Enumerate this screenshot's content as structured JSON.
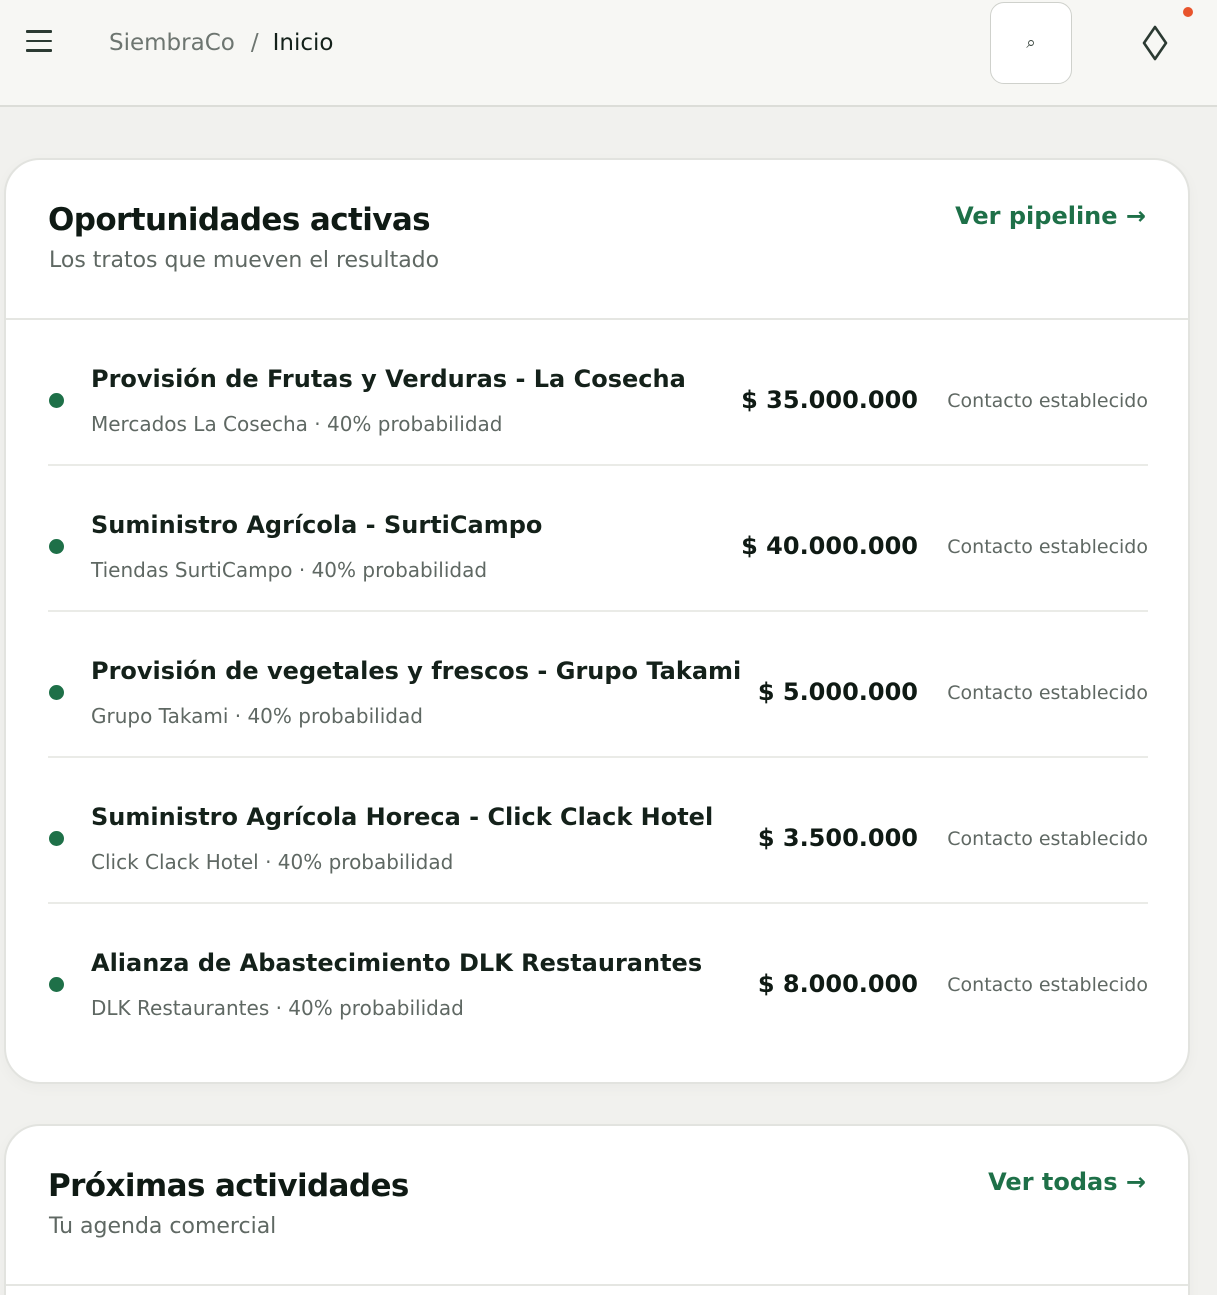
{
  "header": {
    "brand": "SiembraCo",
    "separator": "/",
    "current_page": "Inicio",
    "search_icon_glyph": "⌕",
    "notification_color": "#e8542c"
  },
  "opportunities": {
    "title": "Oportunidades activas",
    "subtitle": "Los tratos que mueven el resultado",
    "link_label": "Ver pipeline →",
    "deals": [
      {
        "title": "Provisión de Frutas y Verduras - La Cosecha",
        "meta": "Mercados La Cosecha · 40% probabilidad",
        "amount": "$ 35.000.000",
        "stage": "Contacto establecido"
      },
      {
        "title": "Suministro Agrícola - SurtiCampo",
        "meta": "Tiendas SurtiCampo · 40% probabilidad",
        "amount": "$ 40.000.000",
        "stage": "Contacto establecido"
      },
      {
        "title": "Provisión de vegetales y frescos - Grupo Takami",
        "meta": "Grupo Takami · 40% probabilidad",
        "amount": "$ 5.000.000",
        "stage": "Contacto establecido"
      },
      {
        "title": "Suministro Agrícola Horeca - Click Clack Hotel",
        "meta": "Click Clack Hotel · 40% probabilidad",
        "amount": "$ 3.500.000",
        "stage": "Contacto establecido"
      },
      {
        "title": "Alianza de Abastecimiento DLK Restaurantes",
        "meta": "DLK Restaurantes · 40% probabilidad",
        "amount": "$ 8.000.000",
        "stage": "Contacto establecido"
      }
    ]
  },
  "activities": {
    "title": "Próximas actividades",
    "subtitle": "Tu agenda comercial",
    "link_label": "Ver todas →"
  },
  "colors": {
    "accent": "#1e7048",
    "background": "#f1f1ee"
  }
}
